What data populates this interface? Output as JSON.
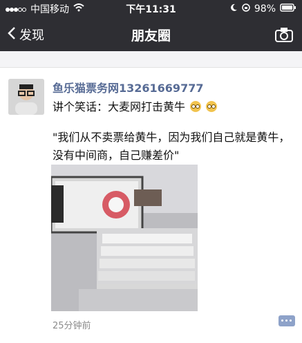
{
  "status": {
    "carrier": "中国移动",
    "time": "下午11:31",
    "battery": "98%"
  },
  "nav": {
    "back_label": "发现",
    "title": "朋友圈"
  },
  "post": {
    "username": "鱼乐猫票务网13261669777",
    "text_line1": "讲个笑话：大麦网打击黄牛",
    "text_line2": "\"我们从不卖票给黄牛，因为我们自己就是黄牛，没有中间商，自己赚差价\"",
    "timestamp": "25分钟前"
  },
  "colors": {
    "bar_bg": "#2e2e33",
    "link_blue": "#576b95",
    "text_dark": "#111111",
    "meta_gray": "#8b8b8b"
  },
  "icons": {
    "back": "chevron-left-icon",
    "camera": "camera-icon",
    "wifi": "wifi-icon",
    "lock": "lock-icon",
    "battery": "battery-icon",
    "comment": "comment-icon"
  }
}
